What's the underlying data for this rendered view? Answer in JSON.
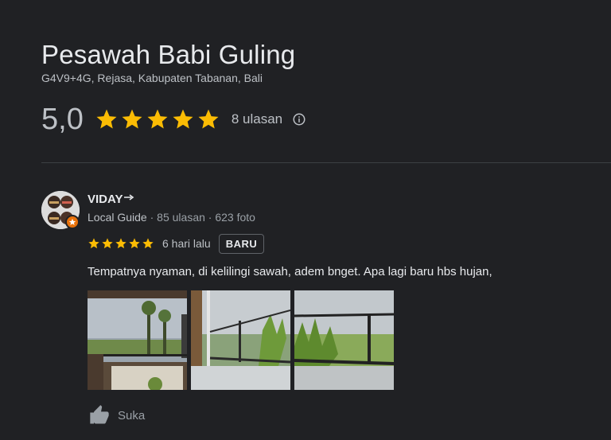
{
  "place": {
    "name": "Pesawah Babi Guling",
    "address": "G4V9+4G, Rejasa, Kabupaten Tabanan, Bali",
    "rating": "5,0",
    "review_count_label": "8 ulasan",
    "star_color": "#fbbc04"
  },
  "review": {
    "reviewer_name": "VIDAY",
    "guide_label": "Local Guide",
    "reviews_count": "85 ulasan",
    "photos_count": "623 foto",
    "rating_stars": 5,
    "time_ago": "6 hari lalu",
    "new_badge": "BARU",
    "text": "Tempatnya nyaman, di kelilingi sawah, adem bnget. Apa lagi baru hbs hujan,",
    "photos": [
      "photo-1",
      "photo-2",
      "photo-3"
    ],
    "like_label": "Suka"
  }
}
